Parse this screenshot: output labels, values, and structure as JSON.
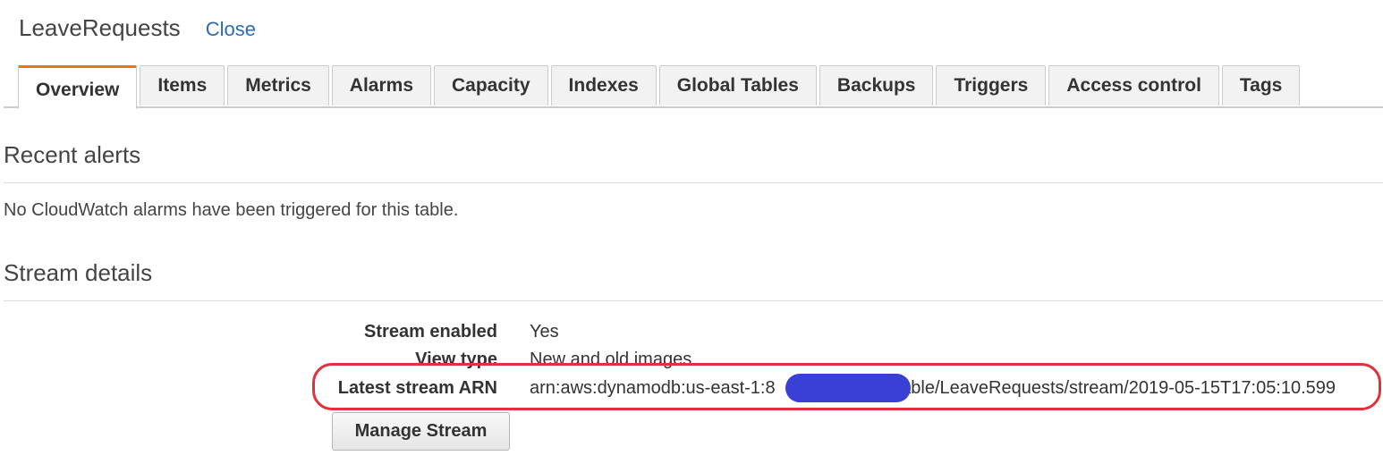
{
  "header": {
    "title": "LeaveRequests",
    "close_label": "Close"
  },
  "tabs": [
    {
      "label": "Overview",
      "active": true
    },
    {
      "label": "Items"
    },
    {
      "label": "Metrics"
    },
    {
      "label": "Alarms"
    },
    {
      "label": "Capacity"
    },
    {
      "label": "Indexes"
    },
    {
      "label": "Global Tables"
    },
    {
      "label": "Backups"
    },
    {
      "label": "Triggers"
    },
    {
      "label": "Access control"
    },
    {
      "label": "Tags"
    }
  ],
  "recent_alerts": {
    "title": "Recent alerts",
    "message": "No CloudWatch alarms have been triggered for this table."
  },
  "stream_details": {
    "title": "Stream details",
    "rows": [
      {
        "label": "Stream enabled",
        "value": "Yes"
      },
      {
        "label": "View type",
        "value": "New and old images"
      },
      {
        "label": "Latest stream ARN",
        "value": "arn:aws:dynamodb:us-east-1:8xxxxxxxxxxxx:table/LeaveRequests/stream/2019-05-15T17:05:10.599"
      }
    ],
    "arn_prefix": "arn:aws:dynamodb:us-east-1:8",
    "arn_suffix": "table/LeaveRequests/stream/2019-05-15T17:05:10.599",
    "manage_button": "Manage Stream"
  },
  "colors": {
    "active_tab_accent": "#e47911",
    "link": "#2a6db5",
    "highlight_outline": "#e0313c",
    "redaction": "#3a3fd6"
  }
}
